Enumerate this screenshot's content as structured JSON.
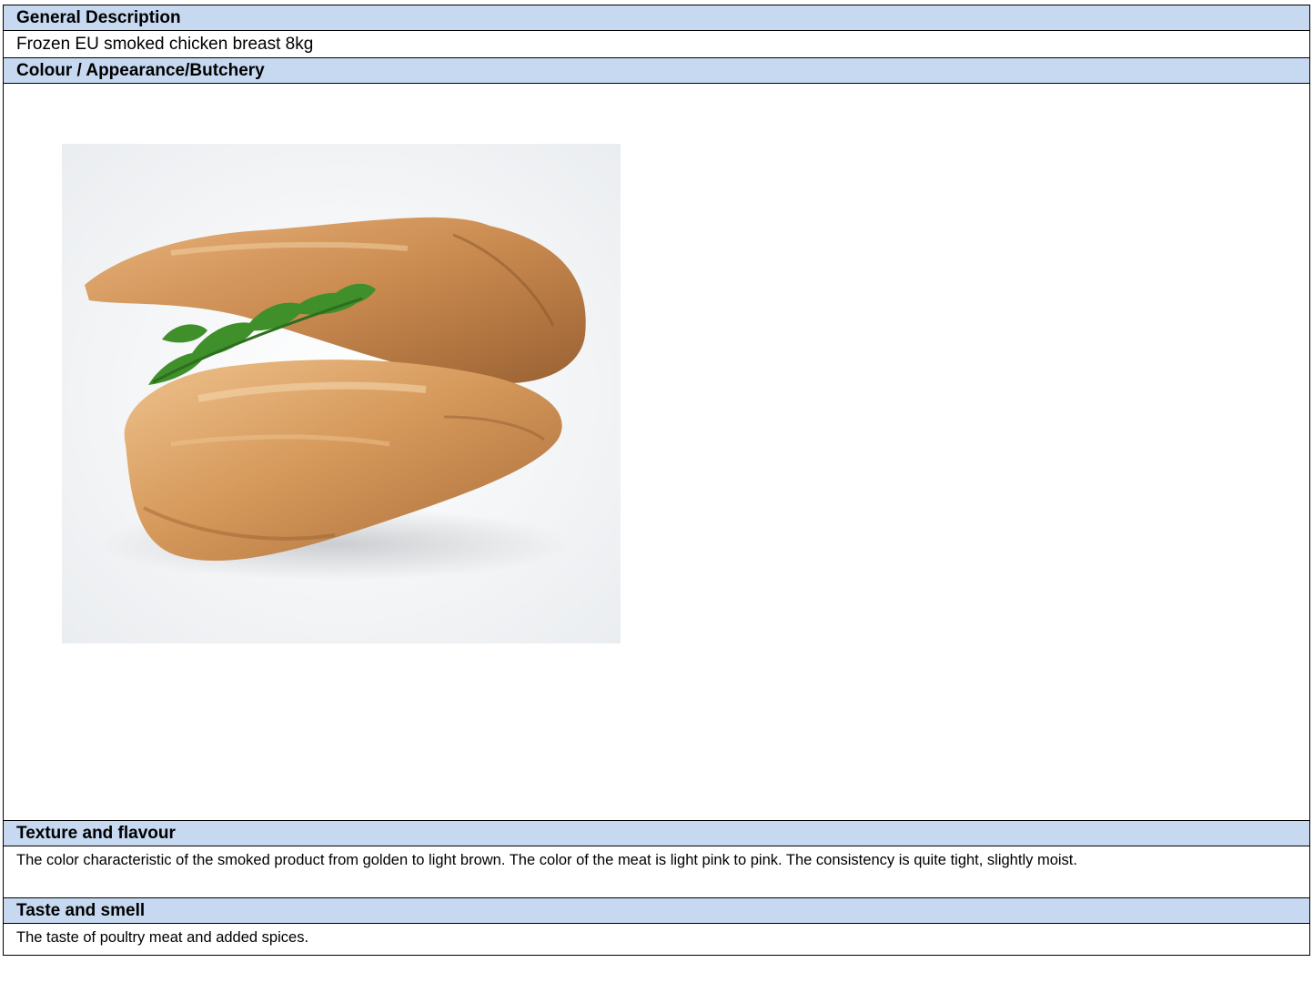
{
  "sections": {
    "general": {
      "header": "General Description",
      "value": "Frozen EU smoked chicken breast 8kg"
    },
    "appearance": {
      "header": "Colour / Appearance/Butchery",
      "image": "smoked-chicken-breast-photo"
    },
    "texture": {
      "header": "Texture and flavour",
      "value": "The color characteristic of the smoked product from golden to light brown. The color of the meat is light pink to pink. The consistency is quite tight, slightly moist."
    },
    "taste": {
      "header": "Taste and smell",
      "value": "The taste of poultry meat and added spices."
    }
  },
  "colors": {
    "header_bg": "#c6d9f1",
    "border": "#000000"
  }
}
